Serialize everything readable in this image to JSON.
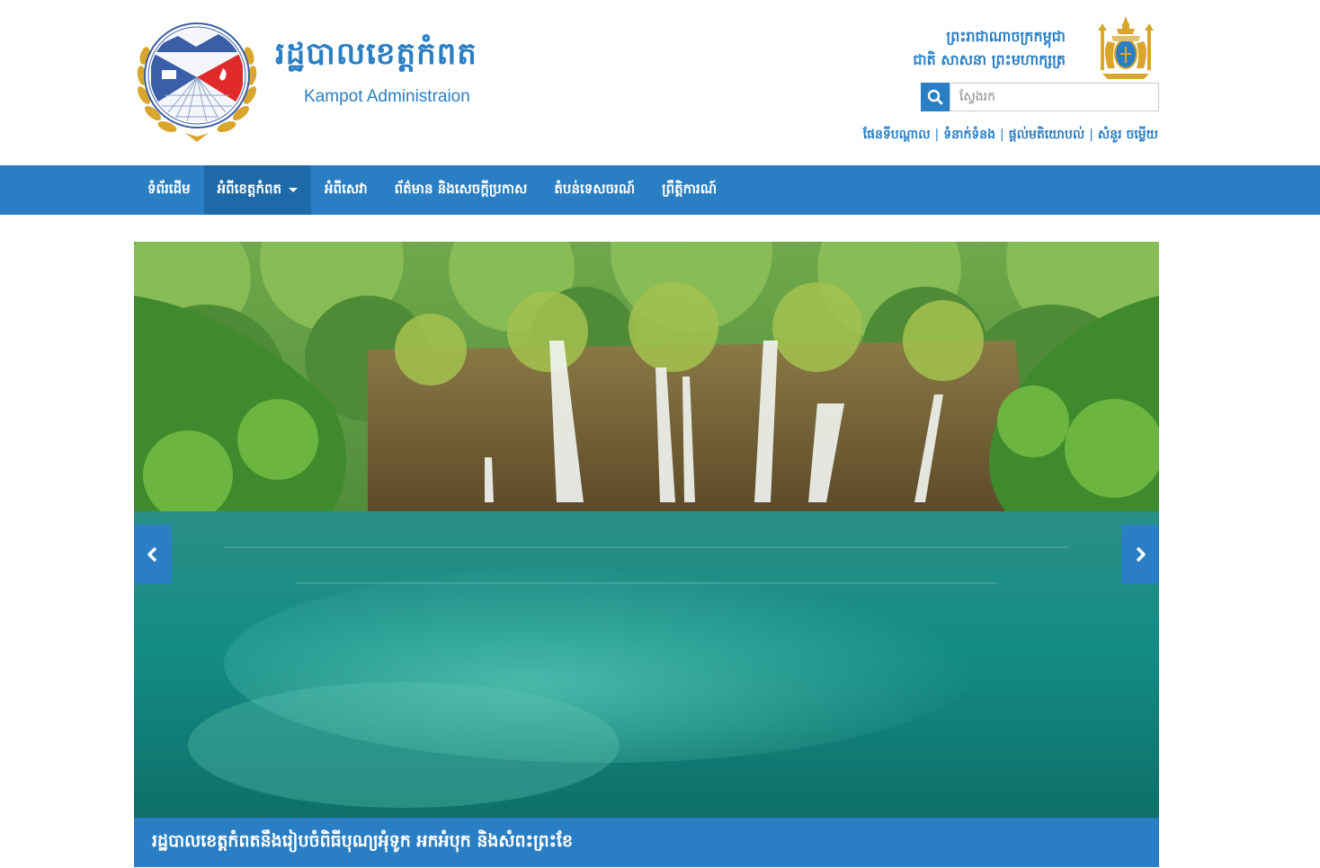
{
  "header": {
    "brand_title": "រដ្ឋបាលខេត្តកំពត",
    "brand_subtitle": "Kampot Administraion",
    "motto_line1": "ព្រះរាជាណាចក្រកម្ពុជា",
    "motto_line2": "ជាតិ សាសនា ព្រះមហាក្សត្រ",
    "logo_icon": "kampot-seal-icon",
    "emblem_icon": "royal-arms-icon"
  },
  "search": {
    "placeholder": "ស្វែងរក",
    "value": "",
    "icon": "search-icon"
  },
  "quick_links": [
    {
      "label": "ផែនទីបណ្ដាល"
    },
    {
      "label": "ទំនាក់ទំនង"
    },
    {
      "label": "ផ្ដល់មតិយោបល់"
    },
    {
      "label": "សំនួរ ចម្លើយ"
    }
  ],
  "nav": {
    "items": [
      {
        "label": "ទំព័រដើម"
      },
      {
        "label": "អំពីខេត្តកំពត",
        "active": true,
        "dropdown": true
      },
      {
        "label": "អំពីសេវា"
      },
      {
        "label": "ព័ត៌មាន និងសេចក្ដីប្រកាស"
      },
      {
        "label": "តំបន់ទេសចរណ៍"
      },
      {
        "label": "ព្រឹត្តិការណ៍"
      }
    ]
  },
  "carousel": {
    "caption": "រដ្ឋបាលខេត្តកំពតនឹងរៀបចំពិធីបុណ្យអុំទូក អកអំបុក និងសំពះព្រះខែ",
    "prev_icon": "chevron-left-icon",
    "next_icon": "chevron-right-icon"
  },
  "colors": {
    "brand_blue": "#2a7fc4",
    "nav_active": "#1e69a7",
    "gold": "#d9a52b"
  }
}
